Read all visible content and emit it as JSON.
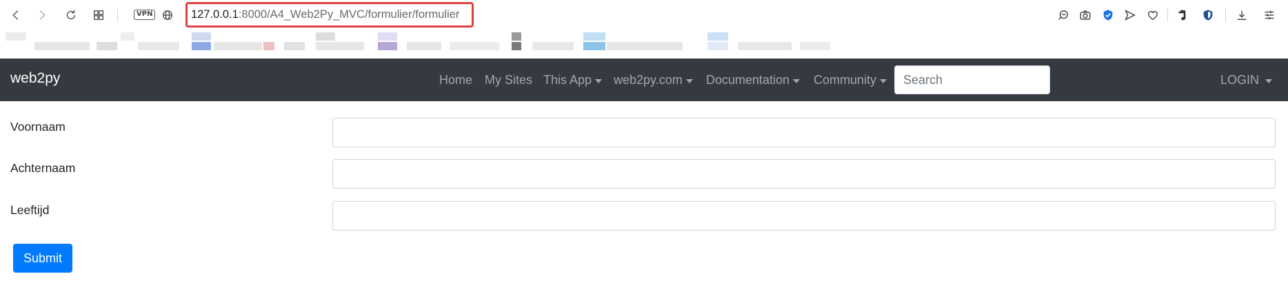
{
  "browser": {
    "address": {
      "host": "127.0.0.1",
      "port_and_path": ":8000/A4_Web2Py_MVC/formulier/formulier"
    },
    "vpn_label": "VPN",
    "toolbar_icons": [
      "back-icon",
      "forward-icon",
      "reload-icon",
      "tabs-grid-icon",
      "vpn-badge",
      "globe-icon"
    ],
    "right_icons": [
      "search-zoom-icon",
      "camera-icon",
      "shield-check-icon",
      "send-icon",
      "heart-icon",
      "evernote-icon",
      "adblock-shield-icon",
      "download-icon",
      "settings-sliders-icon"
    ]
  },
  "navbar": {
    "brand": "web2py",
    "items": [
      {
        "label": "Home",
        "dropdown": false
      },
      {
        "label": "My Sites",
        "dropdown": false
      },
      {
        "label": "This App",
        "dropdown": true
      },
      {
        "label": "web2py.com",
        "dropdown": true
      },
      {
        "label": "Documentation",
        "dropdown": true
      },
      {
        "label": "Community",
        "dropdown": true
      }
    ],
    "search_placeholder": "Search",
    "login_label": "LOGIN"
  },
  "form": {
    "fields": [
      {
        "label": "Voornaam",
        "value": ""
      },
      {
        "label": "Achternaam",
        "value": ""
      },
      {
        "label": "Leeftijd",
        "value": ""
      }
    ],
    "submit_label": "Submit"
  },
  "colors": {
    "navbar_bg": "#343a40",
    "primary": "#007bff",
    "address_highlight": "#e0403d"
  }
}
